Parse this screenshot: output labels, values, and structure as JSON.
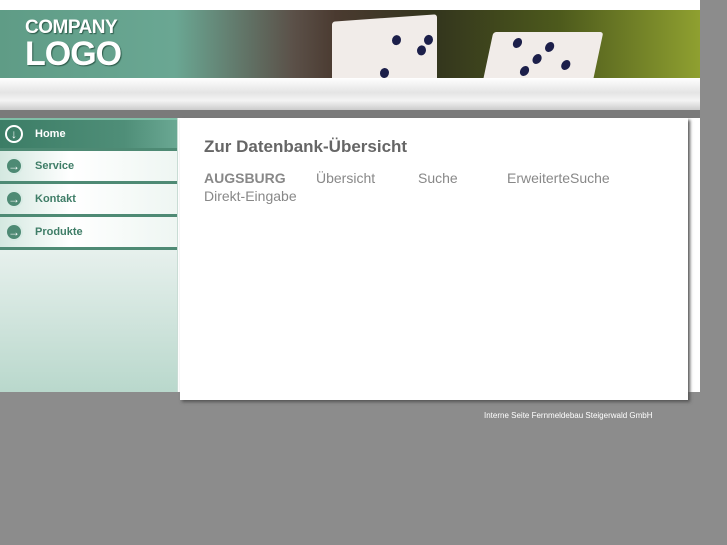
{
  "header": {
    "logo_line1": "COMPANY",
    "logo_line2": "LOGO"
  },
  "sidebar": {
    "items": [
      {
        "label": "Home",
        "icon": "arrow-down-circle-icon",
        "active": true
      },
      {
        "label": "Service",
        "icon": "arrow-right-circle-icon"
      },
      {
        "label": "Kontakt",
        "icon": "arrow-right-circle-icon"
      },
      {
        "label": "Produkte",
        "icon": "arrow-right-circle-icon"
      }
    ]
  },
  "main": {
    "title": "Zur Datenbank-Übersicht",
    "links": [
      "AUGSBURG",
      "Übersicht",
      "Suche",
      "ErweiterteSuche",
      "Direkt-Eingabe"
    ]
  },
  "footer": {
    "text": "Interne Seite Fernmeldebau Steigerwald GmbH"
  },
  "colors": {
    "accent": "#4e8a74",
    "background": "#8c8c8c"
  }
}
